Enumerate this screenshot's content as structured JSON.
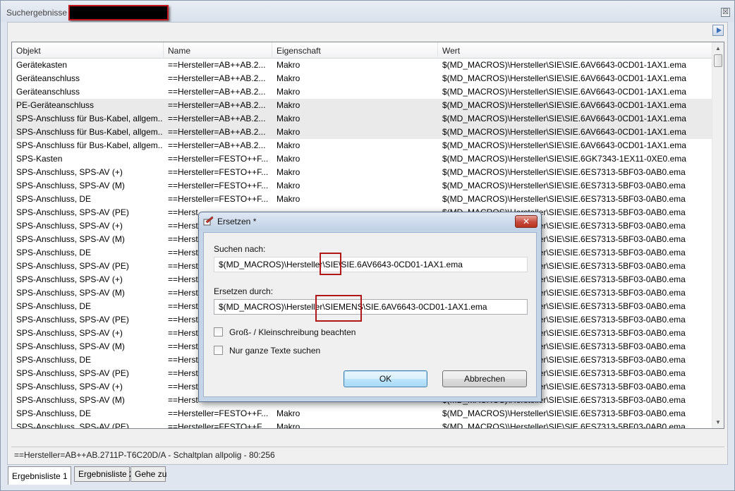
{
  "window": {
    "title": "Suchergebnisse -",
    "close_glyph": "☒"
  },
  "table": {
    "columns": [
      "Objekt",
      "Name",
      "Eigenschaft",
      "Wert"
    ],
    "rows": [
      {
        "objekt": "Gerätekasten",
        "name": "==Hersteller=AB++AB.2...",
        "eig": "Makro",
        "wert": "$(MD_MACROS)\\Hersteller\\SIE\\SIE.6AV6643-0CD01-1AX1.ema",
        "alt": false
      },
      {
        "objekt": "Geräteanschluss",
        "name": "==Hersteller=AB++AB.2...",
        "eig": "Makro",
        "wert": "$(MD_MACROS)\\Hersteller\\SIE\\SIE.6AV6643-0CD01-1AX1.ema",
        "alt": false
      },
      {
        "objekt": "Geräteanschluss",
        "name": "==Hersteller=AB++AB.2...",
        "eig": "Makro",
        "wert": "$(MD_MACROS)\\Hersteller\\SIE\\SIE.6AV6643-0CD01-1AX1.ema",
        "alt": false
      },
      {
        "objekt": "PE-Geräteanschluss",
        "name": "==Hersteller=AB++AB.2...",
        "eig": "Makro",
        "wert": "$(MD_MACROS)\\Hersteller\\SIE\\SIE.6AV6643-0CD01-1AX1.ema",
        "alt": true
      },
      {
        "objekt": "SPS-Anschluss für Bus-Kabel, allgem...",
        "name": "==Hersteller=AB++AB.2...",
        "eig": "Makro",
        "wert": "$(MD_MACROS)\\Hersteller\\SIE\\SIE.6AV6643-0CD01-1AX1.ema",
        "alt": true
      },
      {
        "objekt": "SPS-Anschluss für Bus-Kabel, allgem...",
        "name": "==Hersteller=AB++AB.2...",
        "eig": "Makro",
        "wert": "$(MD_MACROS)\\Hersteller\\SIE\\SIE.6AV6643-0CD01-1AX1.ema",
        "alt": true
      },
      {
        "objekt": "SPS-Anschluss für Bus-Kabel, allgem...",
        "name": "==Hersteller=AB++AB.2...",
        "eig": "Makro",
        "wert": "$(MD_MACROS)\\Hersteller\\SIE\\SIE.6AV6643-0CD01-1AX1.ema",
        "alt": false
      },
      {
        "objekt": "SPS-Kasten",
        "name": "==Hersteller=FESTO++F...",
        "eig": "Makro",
        "wert": "$(MD_MACROS)\\Hersteller\\SIE\\SIE.6GK7343-1EX11-0XE0.ema",
        "alt": false
      },
      {
        "objekt": "SPS-Anschluss, SPS-AV (+)",
        "name": "==Hersteller=FESTO++F...",
        "eig": "Makro",
        "wert": "$(MD_MACROS)\\Hersteller\\SIE\\SIE.6ES7313-5BF03-0AB0.ema",
        "alt": false
      },
      {
        "objekt": "SPS-Anschluss, SPS-AV (M)",
        "name": "==Hersteller=FESTO++F...",
        "eig": "Makro",
        "wert": "$(MD_MACROS)\\Hersteller\\SIE\\SIE.6ES7313-5BF03-0AB0.ema",
        "alt": false
      },
      {
        "objekt": "SPS-Anschluss, DE",
        "name": "==Hersteller=FESTO++F...",
        "eig": "Makro",
        "wert": "$(MD_MACROS)\\Hersteller\\SIE\\SIE.6ES7313-5BF03-0AB0.ema",
        "alt": false
      },
      {
        "objekt": "SPS-Anschluss, SPS-AV (PE)",
        "name": "==Herst",
        "eig": "",
        "wert": "$(MD_MACROS)\\Hersteller\\SIE\\SIE.6ES7313-5BF03-0AB0.ema",
        "alt": false
      },
      {
        "objekt": "SPS-Anschluss, SPS-AV (+)",
        "name": "==Herst",
        "eig": "",
        "wert": "$(MD_MACROS)\\Hersteller\\SIE\\SIE.6ES7313-5BF03-0AB0.ema",
        "alt": false
      },
      {
        "objekt": "SPS-Anschluss, SPS-AV (M)",
        "name": "==Herst",
        "eig": "",
        "wert": "$(MD_MACROS)\\Hersteller\\SIE\\SIE.6ES7313-5BF03-0AB0.ema",
        "alt": false
      },
      {
        "objekt": "SPS-Anschluss, DE",
        "name": "==Herst",
        "eig": "",
        "wert": "$(MD_MACROS)\\Hersteller\\SIE\\SIE.6ES7313-5BF03-0AB0.ema",
        "alt": false
      },
      {
        "objekt": "SPS-Anschluss, SPS-AV (PE)",
        "name": "==Herst",
        "eig": "",
        "wert": "$(MD_MACROS)\\Hersteller\\SIE\\SIE.6ES7313-5BF03-0AB0.ema",
        "alt": false
      },
      {
        "objekt": "SPS-Anschluss, SPS-AV (+)",
        "name": "==Herst",
        "eig": "",
        "wert": "$(MD_MACROS)\\Hersteller\\SIE\\SIE.6ES7313-5BF03-0AB0.ema",
        "alt": false
      },
      {
        "objekt": "SPS-Anschluss, SPS-AV (M)",
        "name": "==Herst",
        "eig": "",
        "wert": "$(MD_MACROS)\\Hersteller\\SIE\\SIE.6ES7313-5BF03-0AB0.ema",
        "alt": false
      },
      {
        "objekt": "SPS-Anschluss, DE",
        "name": "==Herst",
        "eig": "",
        "wert": "$(MD_MACROS)\\Hersteller\\SIE\\SIE.6ES7313-5BF03-0AB0.ema",
        "alt": false
      },
      {
        "objekt": "SPS-Anschluss, SPS-AV (PE)",
        "name": "==Herst",
        "eig": "",
        "wert": "$(MD_MACROS)\\Hersteller\\SIE\\SIE.6ES7313-5BF03-0AB0.ema",
        "alt": false
      },
      {
        "objekt": "SPS-Anschluss, SPS-AV (+)",
        "name": "==Herst",
        "eig": "",
        "wert": "$(MD_MACROS)\\Hersteller\\SIE\\SIE.6ES7313-5BF03-0AB0.ema",
        "alt": false
      },
      {
        "objekt": "SPS-Anschluss, SPS-AV (M)",
        "name": "==Herst",
        "eig": "",
        "wert": "$(MD_MACROS)\\Hersteller\\SIE\\SIE.6ES7313-5BF03-0AB0.ema",
        "alt": false
      },
      {
        "objekt": "SPS-Anschluss, DE",
        "name": "==Herst",
        "eig": "",
        "wert": "$(MD_MACROS)\\Hersteller\\SIE\\SIE.6ES7313-5BF03-0AB0.ema",
        "alt": false
      },
      {
        "objekt": "SPS-Anschluss, SPS-AV (PE)",
        "name": "==Herst",
        "eig": "",
        "wert": "$(MD_MACROS)\\Hersteller\\SIE\\SIE.6ES7313-5BF03-0AB0.ema",
        "alt": false
      },
      {
        "objekt": "SPS-Anschluss, SPS-AV (+)",
        "name": "==Herst",
        "eig": "",
        "wert": "$(MD_MACROS)\\Hersteller\\SIE\\SIE.6ES7313-5BF03-0AB0.ema",
        "alt": false
      },
      {
        "objekt": "SPS-Anschluss, SPS-AV (M)",
        "name": "==Herst",
        "eig": "",
        "wert": "$(MD_MACROS)\\Hersteller\\SIE\\SIE.6ES7313-5BF03-0AB0.ema",
        "alt": false
      },
      {
        "objekt": "SPS-Anschluss, DE",
        "name": "==Hersteller=FESTO++F...",
        "eig": "Makro",
        "wert": "$(MD_MACROS)\\Hersteller\\SIE\\SIE.6ES7313-5BF03-0AB0.ema",
        "alt": false
      },
      {
        "objekt": "SPS-Anschluss, SPS-AV (PE)",
        "name": "==Hersteller=FESTO++F...",
        "eig": "Makro",
        "wert": "$(MD_MACROS)\\Hersteller\\SIE\\SIE.6ES7313-5BF03-0AB0.ema",
        "alt": false
      }
    ]
  },
  "statusbar": {
    "text": "==Hersteller=AB++AB.2711P-T6C20D/A - Schaltplan allpolig - 80:256"
  },
  "tabs": [
    "Ergebnisliste 1",
    "Ergebnisliste 2",
    "Gehe zu"
  ],
  "dialog": {
    "title": "Ersetzen *",
    "close_glyph": "✕",
    "search_label": "Suchen nach:",
    "search_value": "$(MD_MACROS)\\Hersteller\\SIE\\SIE.6AV6643-0CD01-1AX1.ema",
    "replace_label": "Ersetzen durch:",
    "replace_value": "$(MD_MACROS)\\Hersteller\\SIEMENS\\SIE.6AV6643-0CD01-1AX1.ema",
    "match_case_label": "Groß- / Kleinschreibung beachten",
    "match_case_checked": false,
    "whole_text_label": "Nur ganze Texte suchen",
    "whole_text_checked": false,
    "ok_label": "OK",
    "cancel_label": "Abbrechen"
  }
}
